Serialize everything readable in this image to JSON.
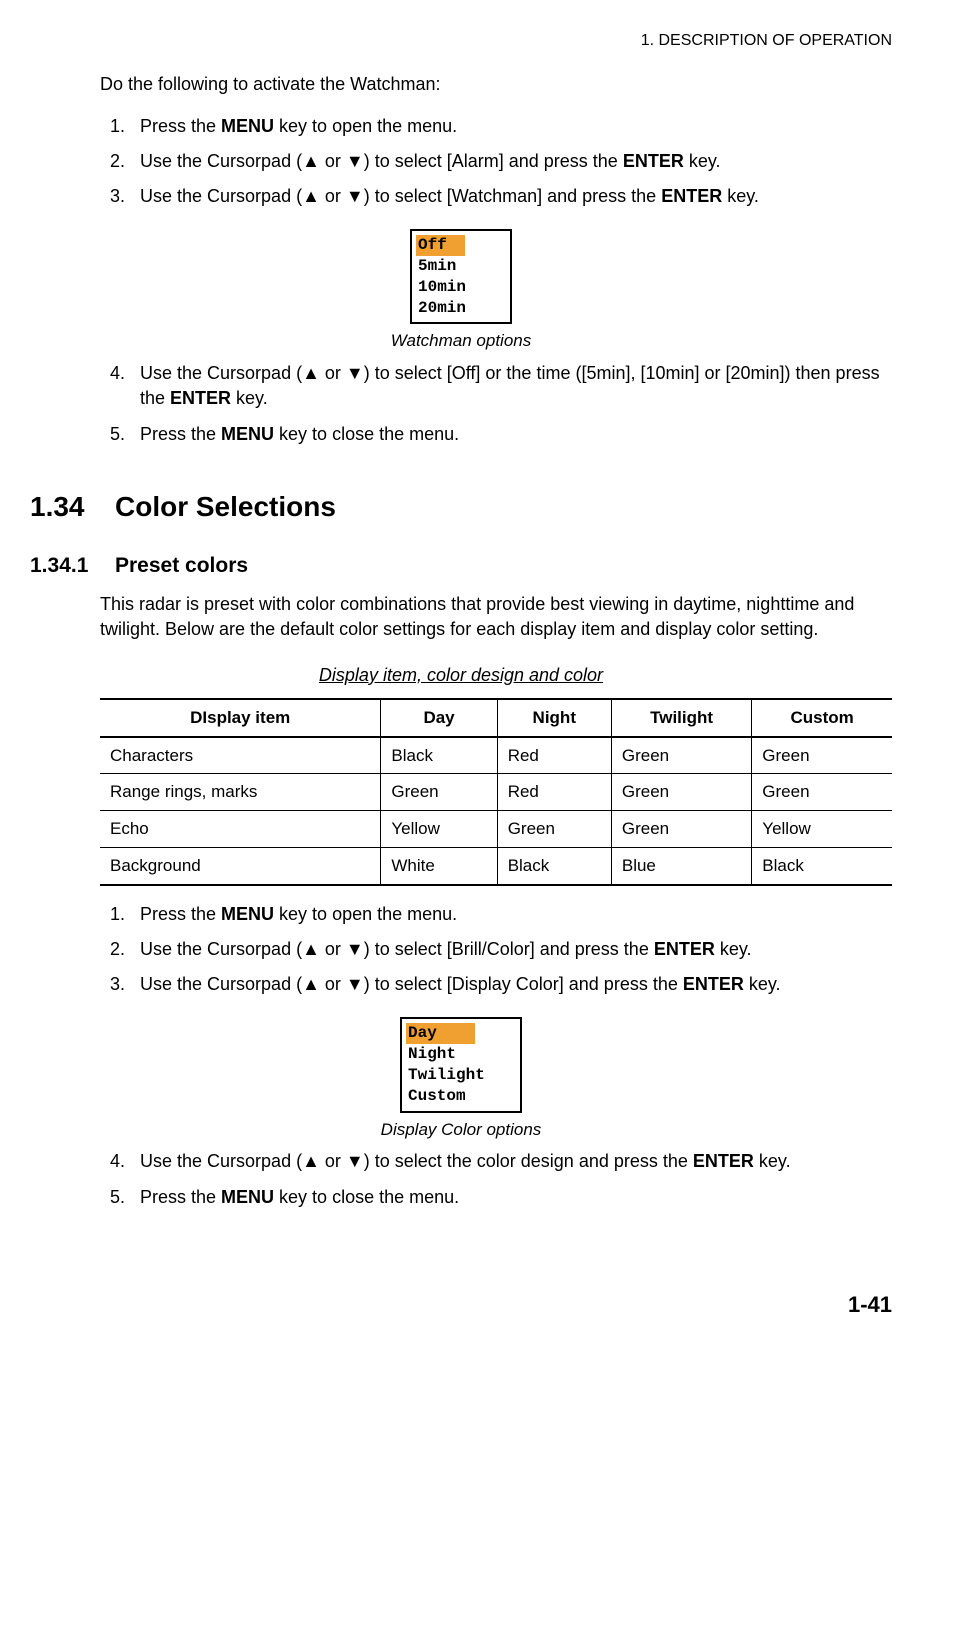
{
  "header": "1.  DESCRIPTION OF OPERATION",
  "intro": "Do the following to activate the Watchman:",
  "steps1": {
    "s1a": "Press the ",
    "s1b": "MENU",
    "s1c": " key to open the menu.",
    "s2a": "Use the Cursorpad (▲ or ▼) to select [Alarm] and press the ",
    "s2b": "ENTER",
    "s2c": " key.",
    "s3a": "Use the Cursorpad (▲ or ▼) to select [Watchman] and press the ",
    "s3b": "ENTER",
    "s3c": " key."
  },
  "watchman_menu": {
    "sel": "Off",
    "o1": "5min",
    "o2": "10min",
    "o3": "20min"
  },
  "caption1": "Watchman options",
  "steps1b": {
    "s4a": "Use the Cursorpad (▲ or ▼) to select [Off] or the time ([5min], [10min] or [20min]) then press the ",
    "s4b": "ENTER",
    "s4c": " key.",
    "s5a": "Press the ",
    "s5b": "MENU",
    "s5c": " key to close the menu."
  },
  "section": {
    "num": "1.34",
    "title": "Color Selections"
  },
  "subsection": {
    "num": "1.34.1",
    "title": "Preset colors"
  },
  "preset_body": "This radar is preset with color combinations that provide best viewing in daytime, nighttime and twilight. Below are the default color settings for each display item and display color setting.",
  "table_title": "Display item, color design and color",
  "table": {
    "headers": [
      "DIsplay item",
      "Day",
      "Night",
      "Twilight",
      "Custom"
    ],
    "rows": [
      [
        "Characters",
        "Black",
        "Red",
        "Green",
        "Green"
      ],
      [
        "Range rings, marks",
        "Green",
        "Red",
        "Green",
        "Green"
      ],
      [
        "Echo",
        "Yellow",
        "Green",
        "Green",
        "Yellow"
      ],
      [
        "Background",
        "White",
        "Black",
        "Blue",
        "Black"
      ]
    ]
  },
  "steps2": {
    "s1a": "Press the ",
    "s1b": "MENU",
    "s1c": " key to open the menu.",
    "s2a": "Use the Cursorpad (▲ or ▼) to select [Brill/Color] and press the ",
    "s2b": "ENTER",
    "s2c": " key.",
    "s3a": "Use the Cursorpad (▲ or ▼) to select [Display Color] and press the ",
    "s3b": "ENTER",
    "s3c": " key."
  },
  "display_menu": {
    "sel": "Day",
    "o1": "Night",
    "o2": "Twilight",
    "o3": "Custom"
  },
  "caption2": "Display Color options",
  "steps2b": {
    "s4a": "Use the Cursorpad (▲ or ▼) to select the color design and press the ",
    "s4b": "ENTER",
    "s4c": " key.",
    "s5a": "Press the ",
    "s5b": "MENU",
    "s5c": " key to close the menu."
  },
  "page_num": "1-41"
}
